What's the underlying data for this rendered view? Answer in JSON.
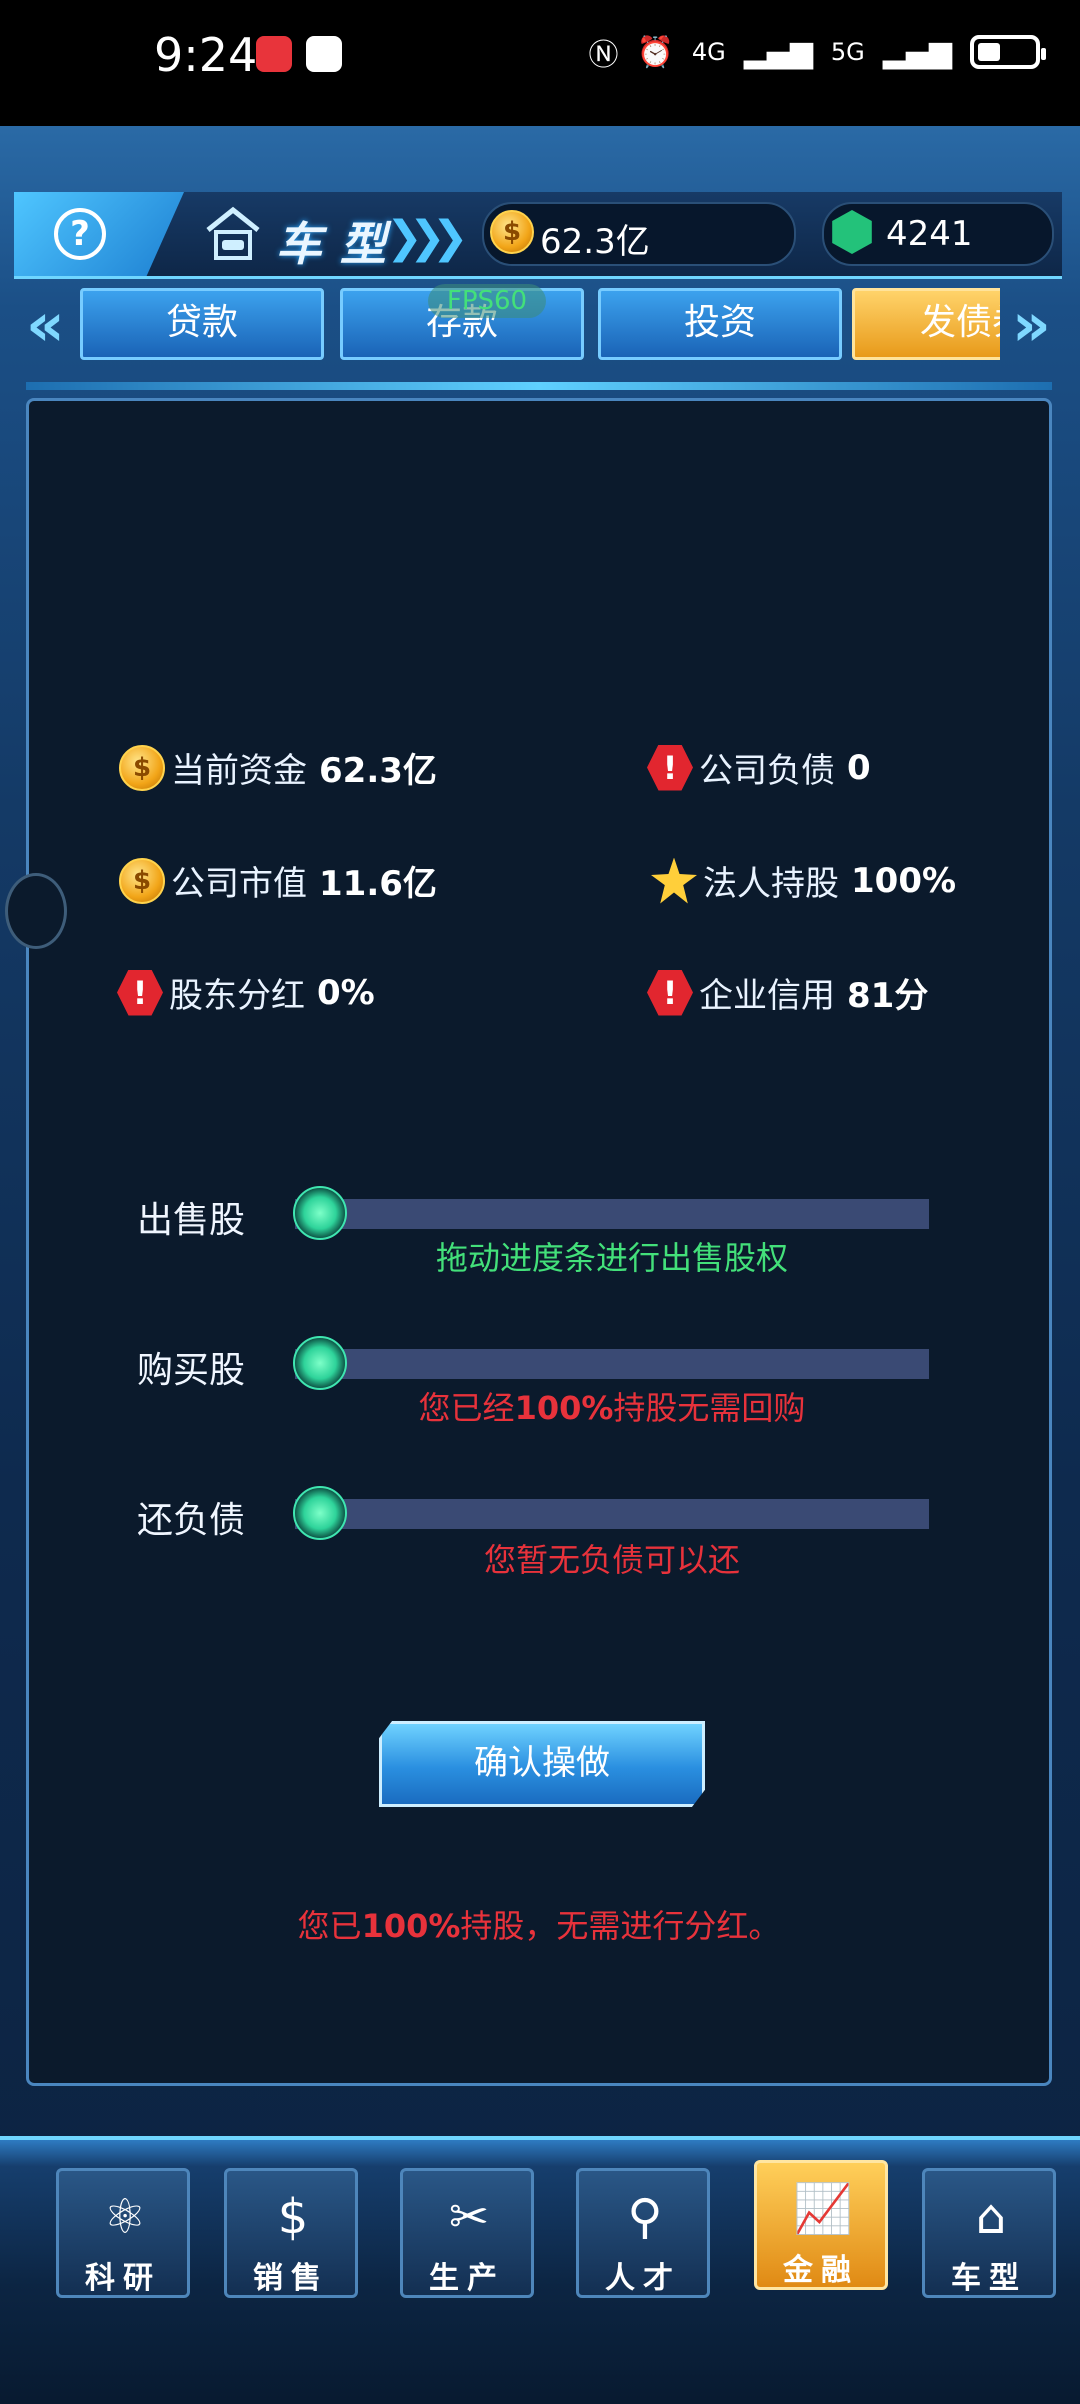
{
  "status_bar": {
    "time": "9:24",
    "network_1": "4G",
    "network_2": "5G"
  },
  "top_bar": {
    "help_icon": "question-icon",
    "title": "车型",
    "money": "62.3亿",
    "gems": "4241"
  },
  "tabs": {
    "items": [
      {
        "label": "贷款"
      },
      {
        "label": "存款"
      },
      {
        "label": "投资"
      },
      {
        "label": "发债券"
      }
    ],
    "badge": "FPS60"
  },
  "stats": {
    "current_funds": {
      "label": "当前资金",
      "value": "62.3亿"
    },
    "company_debt": {
      "label": "公司负债",
      "value": "0"
    },
    "market_value": {
      "label": "公司市值",
      "value": "11.6亿"
    },
    "legal_holding": {
      "label": "法人持股",
      "value": "100%"
    },
    "dividend": {
      "label": "股东分红",
      "value": "0%"
    },
    "credit": {
      "label": "企业信用",
      "value": "81分"
    }
  },
  "sliders": {
    "sell": {
      "label": "出售股",
      "progress": 0,
      "hint": "拖动进度条进行出售股权"
    },
    "buy": {
      "label": "购买股",
      "progress": 0,
      "hint_pre": "您已经",
      "hint_bold": "100%",
      "hint_post": "持股无需回购"
    },
    "repay": {
      "label": "还负债",
      "progress": 0,
      "hint": "您暂无负债可以还"
    }
  },
  "confirm_label": "确认操做",
  "notice": {
    "pre": "您已",
    "bold": "100%",
    "post": "持股，无需进行分红。"
  },
  "bottom_nav": [
    {
      "label": "科研",
      "icon": "research-icon"
    },
    {
      "label": "销售",
      "icon": "sales-icon"
    },
    {
      "label": "生产",
      "icon": "production-icon"
    },
    {
      "label": "人才",
      "icon": "talent-icon"
    },
    {
      "label": "金融",
      "icon": "finance-icon",
      "active": true
    },
    {
      "label": "车型",
      "icon": "car-model-icon"
    }
  ],
  "colors": {
    "accent": "#4fc6ff",
    "hint_green": "#43e07a",
    "hint_red": "#e8323b",
    "active_gold": "#f2a518"
  }
}
